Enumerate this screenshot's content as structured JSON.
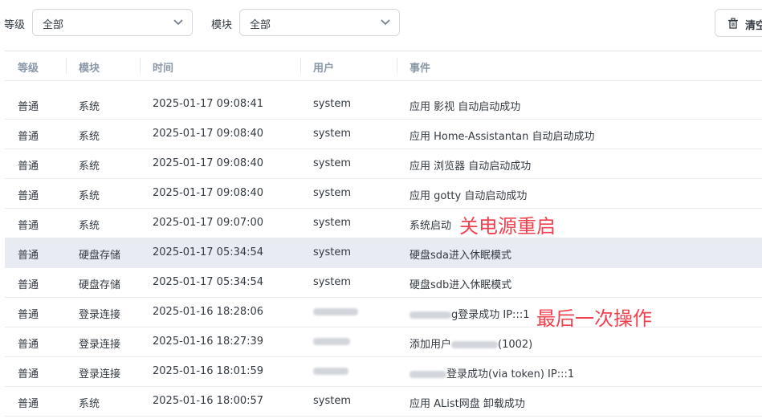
{
  "filters": {
    "level_label": "等级",
    "level_value": "全部",
    "module_label": "模块",
    "module_value": "全部",
    "clear_label": "清空",
    "clear_icon": "trash-icon",
    "dropdown_icon": "chevron-down-icon"
  },
  "table": {
    "columns": [
      "等级",
      "模块",
      "时间",
      "用户",
      "事件"
    ],
    "rows": [
      {
        "level": "普通",
        "module": "系统",
        "time": "2025-01-17 09:08:41",
        "user": "system",
        "event": "应用 影视 自动启动成功"
      },
      {
        "level": "普通",
        "module": "系统",
        "time": "2025-01-17 09:08:40",
        "user": "system",
        "event": "应用 Home-Assistantan 自动启动成功"
      },
      {
        "level": "普通",
        "module": "系统",
        "time": "2025-01-17 09:08:40",
        "user": "system",
        "event": "应用 浏览器 自动启动成功"
      },
      {
        "level": "普通",
        "module": "系统",
        "time": "2025-01-17 09:08:40",
        "user": "system",
        "event": "应用 gotty 自动启动成功"
      },
      {
        "level": "普通",
        "module": "系统",
        "time": "2025-01-17 09:07:00",
        "user": "system",
        "event": "系统启动"
      },
      {
        "level": "普通",
        "module": "硬盘存储",
        "time": "2025-01-17 05:34:54",
        "user": "system",
        "event": "硬盘sda进入休眠模式"
      },
      {
        "level": "普通",
        "module": "硬盘存储",
        "time": "2025-01-17 05:34:54",
        "user": "system",
        "event": "硬盘sdb进入休眠模式"
      },
      {
        "level": "普通",
        "module": "登录连接",
        "time": "2025-01-16 18:28:06",
        "user": "",
        "event": "g登录成功 IP:::1"
      },
      {
        "level": "普通",
        "module": "登录连接",
        "time": "2025-01-16 18:27:39",
        "user": "",
        "event_prefix": "添加用户",
        "event": "(1002)"
      },
      {
        "level": "普通",
        "module": "登录连接",
        "time": "2025-01-16 18:01:59",
        "user": "",
        "event": "登录成功(via token) IP:::1"
      },
      {
        "level": "普通",
        "module": "系统",
        "time": "2025-01-16 18:00:57",
        "user": "system",
        "event": "应用 AList网盘 卸载成功"
      }
    ]
  },
  "annotations": {
    "reboot_note": "关电源重启",
    "last_op_note": "最后一次操作",
    "note_color": "#f0414f"
  },
  "colors": {
    "highlight_row": "#e8ebf1",
    "header_text": "#8a97a6"
  }
}
